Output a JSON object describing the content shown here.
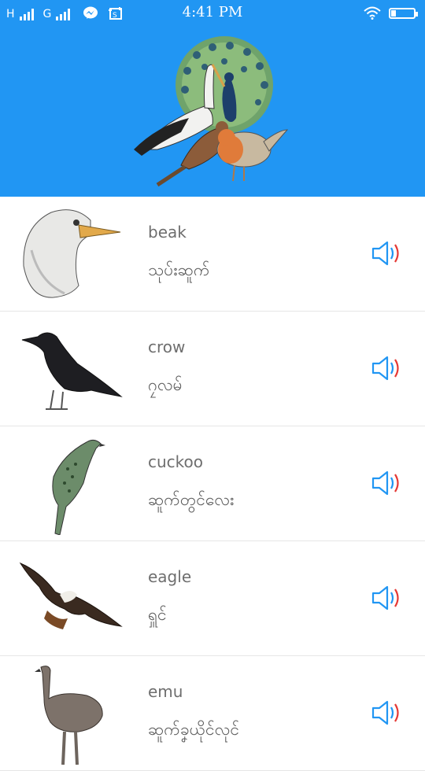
{
  "status_bar": {
    "net1": "H",
    "net2": "G",
    "time": "4:41 PM"
  },
  "words": [
    {
      "english": "beak",
      "burmese": "သုပ်းဆူက်"
    },
    {
      "english": "crow",
      "burmese": "ဂၠလမ်"
    },
    {
      "english": "cuckoo",
      "burmese": "ဆူက်တွင်လေး"
    },
    {
      "english": "eagle",
      "burmese": "ရှူင်"
    },
    {
      "english": "emu",
      "burmese": "ဆူက်ခၞယိုင်လုင်"
    }
  ],
  "colors": {
    "accent": "#2196f3",
    "speaker_blue": "#2196f3",
    "speaker_red": "#e53935"
  }
}
